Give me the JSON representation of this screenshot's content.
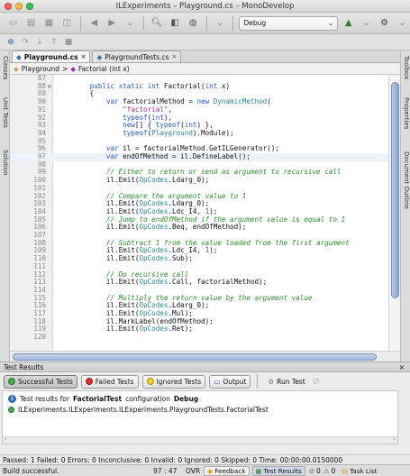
{
  "window": {
    "title": "ILExperiments – Playground.cs – MonoDevelop"
  },
  "toolbar": {
    "config": "Debug"
  },
  "left_pads": [
    "Classes",
    "Unit Tests",
    "Solution"
  ],
  "right_pads": [
    "Toolbox",
    "Properties",
    "Document Outline"
  ],
  "tabs": [
    {
      "label": "Playground.cs",
      "close": "×"
    },
    {
      "label": "PlaygroundTests.cs",
      "close": "×"
    }
  ],
  "breadcrumb": {
    "class": "Playground",
    "sep": ">",
    "method": "Factorial (int x)"
  },
  "code": [
    {
      "n": "87",
      "t": []
    },
    {
      "n": "88",
      "fold": "⊟",
      "t": [
        [
          "",
          "        "
        ],
        [
          "kw",
          "public static int "
        ],
        [
          "",
          "Factorial("
        ],
        [
          "kw",
          "int"
        ],
        [
          "",
          " x)"
        ]
      ]
    },
    {
      "n": "89",
      "t": [
        [
          "",
          "        {"
        ]
      ]
    },
    {
      "n": "90",
      "t": [
        [
          "",
          "            "
        ],
        [
          "kw",
          "var"
        ],
        [
          "",
          " factorialMethod = "
        ],
        [
          "kw",
          "new "
        ],
        [
          "ty",
          "DynamicMethod"
        ],
        [
          "",
          "("
        ]
      ]
    },
    {
      "n": "91",
      "t": [
        [
          "",
          "                "
        ],
        [
          "str",
          "\"factorial\""
        ],
        [
          "",
          ","
        ]
      ]
    },
    {
      "n": "92",
      "t": [
        [
          "",
          "                "
        ],
        [
          "kw",
          "typeof"
        ],
        [
          "",
          "("
        ],
        [
          "kw",
          "int"
        ],
        [
          "",
          "),"
        ]
      ]
    },
    {
      "n": "93",
      "t": [
        [
          "",
          "                "
        ],
        [
          "kw",
          "new"
        ],
        [
          "",
          "[] { "
        ],
        [
          "kw",
          "typeof"
        ],
        [
          "",
          "("
        ],
        [
          "kw",
          "int"
        ],
        [
          "",
          ") },"
        ]
      ]
    },
    {
      "n": "94",
      "t": [
        [
          "",
          "                "
        ],
        [
          "kw",
          "typeof"
        ],
        [
          "",
          "("
        ],
        [
          "ty",
          "Playground"
        ],
        [
          "",
          ").Module);"
        ]
      ]
    },
    {
      "n": "95",
      "t": []
    },
    {
      "n": "96",
      "t": [
        [
          "",
          "            "
        ],
        [
          "kw",
          "var"
        ],
        [
          "",
          " il = factorialMethod.GetILGenerator();"
        ]
      ]
    },
    {
      "n": "97",
      "t": [
        [
          "",
          "            "
        ],
        [
          "kw",
          "var"
        ],
        [
          "",
          " endOfMethod = il.DefineLabel();"
        ]
      ]
    },
    {
      "n": "98",
      "t": []
    },
    {
      "n": "99",
      "t": [
        [
          "",
          "            "
        ],
        [
          "cmt",
          "// Either to return or send as argument to recursive call"
        ]
      ]
    },
    {
      "n": "100",
      "t": [
        [
          "",
          "            il.Emit("
        ],
        [
          "ty",
          "OpCodes"
        ],
        [
          "",
          ".Ldarg_0);"
        ]
      ]
    },
    {
      "n": "101",
      "t": []
    },
    {
      "n": "102",
      "t": [
        [
          "",
          "            "
        ],
        [
          "cmt",
          "// Compare the argument value to 1"
        ]
      ]
    },
    {
      "n": "103",
      "t": [
        [
          "",
          "            il.Emit("
        ],
        [
          "ty",
          "OpCodes"
        ],
        [
          "",
          ".Ldarg_0);"
        ]
      ]
    },
    {
      "n": "104",
      "t": [
        [
          "",
          "            il.Emit("
        ],
        [
          "ty",
          "OpCodes"
        ],
        [
          "",
          ".Ldc_I4, "
        ],
        [
          "num",
          "1"
        ],
        [
          "",
          ");"
        ]
      ]
    },
    {
      "n": "105",
      "t": [
        [
          "",
          "            "
        ],
        [
          "cmt",
          "// Jump to endOfMethod if the argument value is equal to 1"
        ]
      ]
    },
    {
      "n": "106",
      "t": [
        [
          "",
          "            il.Emit("
        ],
        [
          "ty",
          "OpCodes"
        ],
        [
          "",
          ".Beq, endOfMethod);"
        ]
      ]
    },
    {
      "n": "107",
      "t": []
    },
    {
      "n": "108",
      "t": [
        [
          "",
          "            "
        ],
        [
          "cmt",
          "// Subtract 1 from the value loaded from the first argument"
        ]
      ]
    },
    {
      "n": "109",
      "t": [
        [
          "",
          "            il.Emit("
        ],
        [
          "ty",
          "OpCodes"
        ],
        [
          "",
          ".Ldc_I4, "
        ],
        [
          "num",
          "1"
        ],
        [
          "",
          ");"
        ]
      ]
    },
    {
      "n": "110",
      "t": [
        [
          "",
          "            il.Emit("
        ],
        [
          "ty",
          "OpCodes"
        ],
        [
          "",
          ".Sub);"
        ]
      ]
    },
    {
      "n": "111",
      "t": []
    },
    {
      "n": "112",
      "t": [
        [
          "",
          "            "
        ],
        [
          "cmt",
          "// Do recursive call"
        ]
      ]
    },
    {
      "n": "113",
      "t": [
        [
          "",
          "            il.Emit("
        ],
        [
          "ty",
          "OpCodes"
        ],
        [
          "",
          ".Call, factorialMethod);"
        ]
      ]
    },
    {
      "n": "114",
      "t": []
    },
    {
      "n": "115",
      "t": [
        [
          "",
          "            "
        ],
        [
          "cmt",
          "// Multiply the return value by the argument value"
        ]
      ]
    },
    {
      "n": "116",
      "t": [
        [
          "",
          "            il.Emit("
        ],
        [
          "ty",
          "OpCodes"
        ],
        [
          "",
          ".Ldarg_0);"
        ]
      ]
    },
    {
      "n": "117",
      "t": [
        [
          "",
          "            il.Emit("
        ],
        [
          "ty",
          "OpCodes"
        ],
        [
          "",
          ".Mul);"
        ]
      ]
    },
    {
      "n": "118",
      "t": [
        [
          "",
          "            il.MarkLabel(endOfMethod);"
        ]
      ]
    },
    {
      "n": "119",
      "t": [
        [
          "",
          "            il.Emit("
        ],
        [
          "ty",
          "OpCodes"
        ],
        [
          "",
          ".Ret);"
        ]
      ]
    },
    {
      "n": "120",
      "t": []
    }
  ],
  "results": {
    "title": "Test Results",
    "close": "×",
    "buttons": {
      "successful": "Successful Tests",
      "failed": "Failed Tests",
      "ignored": "Ignored Tests",
      "output": "Output",
      "run": "Run Test"
    },
    "info_prefix": "Test results for",
    "info_test": "FactorialTest",
    "info_mid": "configuration",
    "info_config": "Debug",
    "entry": "ILExperiments.ILExperiments.ILExperiments.PlaygroundTests.FactorialTest",
    "summary": "Passed: 1   Failed: 0   Errors: 0   Inconclusive: 0   Invalid: 0   Ignored: 0   Skipped: 0   Time: 00:00:00.0150000"
  },
  "status": {
    "message": "Build successful.",
    "cursor": "97 : 47",
    "mode": "OVR",
    "feedback": "Feedback",
    "test_results": "Test Results",
    "errors": "0",
    "warnings": "0",
    "task_list": "Task List"
  },
  "colors": {
    "green": "#3cb043",
    "red": "#e0322a",
    "yellow": "#f2d027"
  }
}
